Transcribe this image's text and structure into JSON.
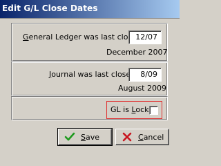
{
  "window": {
    "title": "Edit G/L Close Dates"
  },
  "general_ledger": {
    "label_prefix": "G",
    "label_rest": "eneral Ledger was last closed",
    "value": "12/07",
    "date_text": "December 2007"
  },
  "journal": {
    "label_prefix": "J",
    "label_rest": "ournal was last closed",
    "value": "8/09",
    "date_text": "August 2009"
  },
  "lock": {
    "label_part1": "GL is ",
    "label_accel": "L",
    "label_part2": "ocked",
    "checked": false
  },
  "buttons": {
    "save": {
      "accel": "S",
      "rest": "ave",
      "icon": "checkmark-icon"
    },
    "cancel": {
      "accel": "C",
      "rest": "ancel",
      "icon": "x-mark-icon"
    }
  },
  "colors": {
    "title_bar_start": "#0a246a",
    "title_bar_end": "#a6caf0",
    "highlight_border": "#e03030",
    "save_icon": "#1f9a1f",
    "cancel_icon": "#c8141e"
  }
}
